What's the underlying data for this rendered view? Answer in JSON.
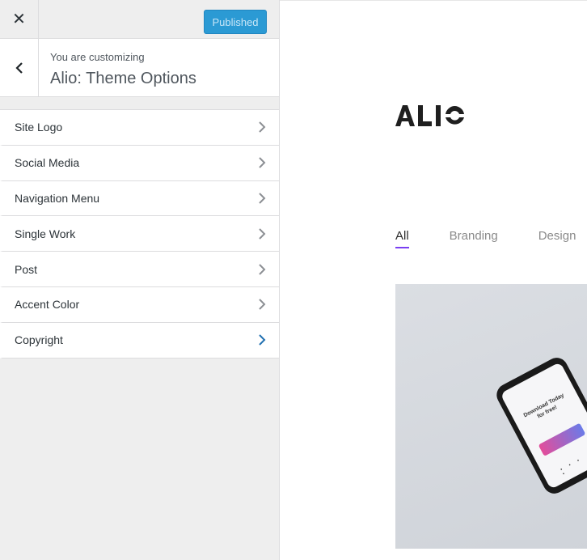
{
  "topbar": {
    "close_glyph": "✕",
    "publish_label": "Published"
  },
  "info": {
    "subtitle": "You are customizing",
    "title": "Alio: Theme Options"
  },
  "sections": [
    {
      "label": "Site Logo"
    },
    {
      "label": "Social Media"
    },
    {
      "label": "Navigation Menu"
    },
    {
      "label": "Single Work"
    },
    {
      "label": "Post"
    },
    {
      "label": "Accent Color"
    },
    {
      "label": "Copyright"
    }
  ],
  "preview": {
    "logo": "ALIO",
    "filters": [
      "All",
      "Branding",
      "Design"
    ],
    "phone_text": "Download Today for free!"
  },
  "colors": {
    "publish_button": "#2b9ad4",
    "accent_underline": "#7a3ff2",
    "active_chevron": "#2271b1",
    "chevron": "#8c8f94"
  }
}
